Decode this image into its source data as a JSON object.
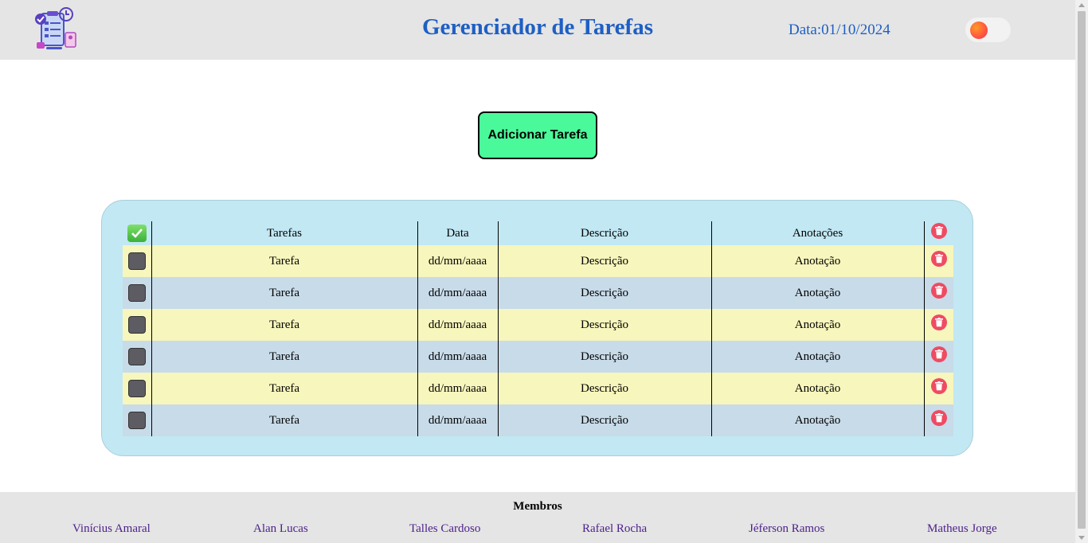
{
  "header": {
    "title": "Gerenciador de Tarefas",
    "date": "Data:01/10/2024",
    "logo_icon": "task-checklist-logo-icon",
    "theme_toggle_icon": "theme-toggle-icon"
  },
  "actions": {
    "add_task_label": "Adicionar Tarefa"
  },
  "table": {
    "columns": [
      "Tarefas",
      "Data",
      "Descrição",
      "Anotações"
    ],
    "rows": [
      {
        "task": "Tarefa",
        "date": "dd/mm/aaaa",
        "description": "Descrição",
        "notes": "Anotação"
      },
      {
        "task": "Tarefa",
        "date": "dd/mm/aaaa",
        "description": "Descrição",
        "notes": "Anotação"
      },
      {
        "task": "Tarefa",
        "date": "dd/mm/aaaa",
        "description": "Descrição",
        "notes": "Anotação"
      },
      {
        "task": "Tarefa",
        "date": "dd/mm/aaaa",
        "description": "Descrição",
        "notes": "Anotação"
      },
      {
        "task": "Tarefa",
        "date": "dd/mm/aaaa",
        "description": "Descrição",
        "notes": "Anotação"
      },
      {
        "task": "Tarefa",
        "date": "dd/mm/aaaa",
        "description": "Descrição",
        "notes": "Anotação"
      }
    ]
  },
  "footer": {
    "title": "Membros",
    "members": [
      "Vinícius Amaral",
      "Alan Lucas",
      "Talles Cardoso",
      "Rafael Rocha",
      "Jéferson Ramos",
      "Matheus Jorge"
    ]
  },
  "colors": {
    "header_bg": "#e5e5e5",
    "title": "#1e5fc4",
    "add_button": "#4afa9a",
    "card_bg": "#c2e8f3",
    "row_odd": "#f7f6bc",
    "row_even": "#c8dbe9",
    "delete": "#ef4b63",
    "member_link": "#4b1f8a"
  }
}
